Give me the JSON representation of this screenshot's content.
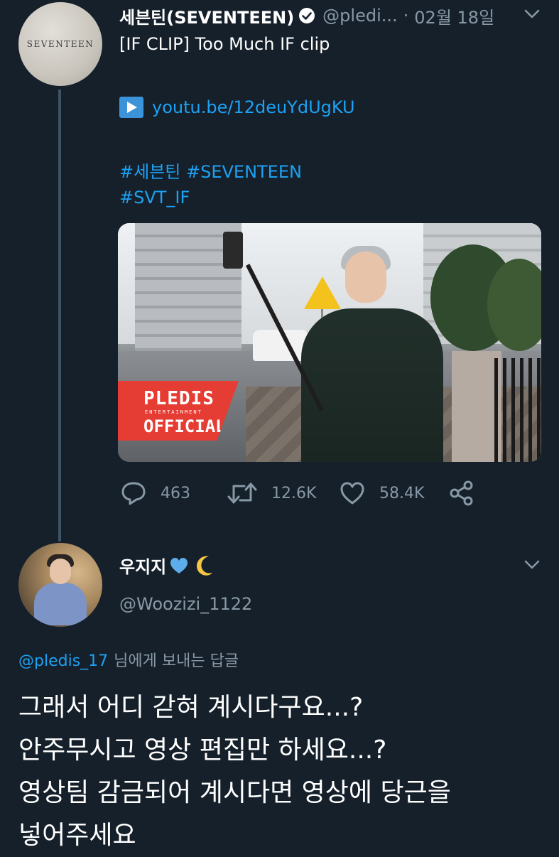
{
  "tweet": {
    "author_name": "세븐틴(SEVENTEEN)",
    "handle": "@pledi...",
    "separator": "·",
    "date": "02월 18일",
    "avatar_text": "SEVENTEEN",
    "title": "[IF CLIP] Too Much IF clip",
    "link": "youtu.be/12deuYdUgKU",
    "hashtags_line1": "#세븐틴 #SEVENTEEN",
    "hashtags_line2": "#SVT_IF",
    "media": {
      "watermark_line1": "PLEDIS",
      "watermark_line2": "ENTERTAINMENT",
      "watermark_line3": "OFFICIAL"
    },
    "stats": {
      "replies": "463",
      "retweets": "12.6K",
      "likes": "58.4K"
    }
  },
  "reply": {
    "author_name": "우지지",
    "handle": "@Woozizi_1122",
    "replying_to_handle": "@pledis_17",
    "replying_to_text": "님에게 보내는 답글",
    "lines": [
      "그래서 어디 갇혀 계시다구요...?",
      "안주무시고 영상 편집만 하세요...?",
      "영상팀 감금되어 계시다면 영상에 당근을",
      "넣어주세요"
    ]
  },
  "colors": {
    "background": "#15202b",
    "link_blue": "#1da1f2",
    "muted": "#8899a6",
    "heart_blue": "#3b94d9",
    "watermark_red": "#e53c33"
  },
  "icons": [
    "verified-icon",
    "chevron-down-icon",
    "play-icon",
    "reply-icon",
    "retweet-icon",
    "like-icon",
    "share-icon",
    "blue-heart-icon",
    "crescent-moon-icon"
  ]
}
